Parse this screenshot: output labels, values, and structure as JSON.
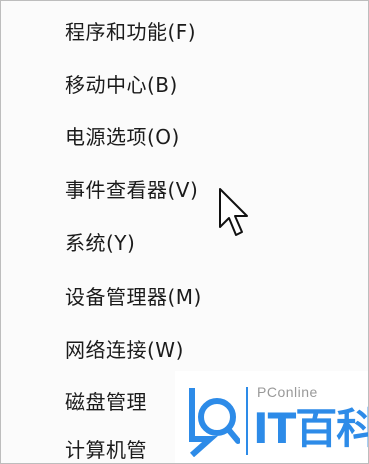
{
  "menu": {
    "items": [
      {
        "label": "程序和功能(F)"
      },
      {
        "label": "移动中心(B)"
      },
      {
        "label": "电源选项(O)"
      },
      {
        "label": "事件查看器(V)"
      },
      {
        "label": "系统(Y)"
      },
      {
        "label": "设备管理器(M)"
      },
      {
        "label": "网络连接(W)"
      },
      {
        "label": "磁盘管理"
      },
      {
        "label": "计算机管"
      }
    ]
  },
  "cursor": {
    "icon": "arrow-pointer-icon"
  },
  "watermark": {
    "brand_small": "PConline",
    "brand_big": "IT百科",
    "icon": "search-magnifier-logo-icon",
    "accent_color": "#2d8be8"
  }
}
